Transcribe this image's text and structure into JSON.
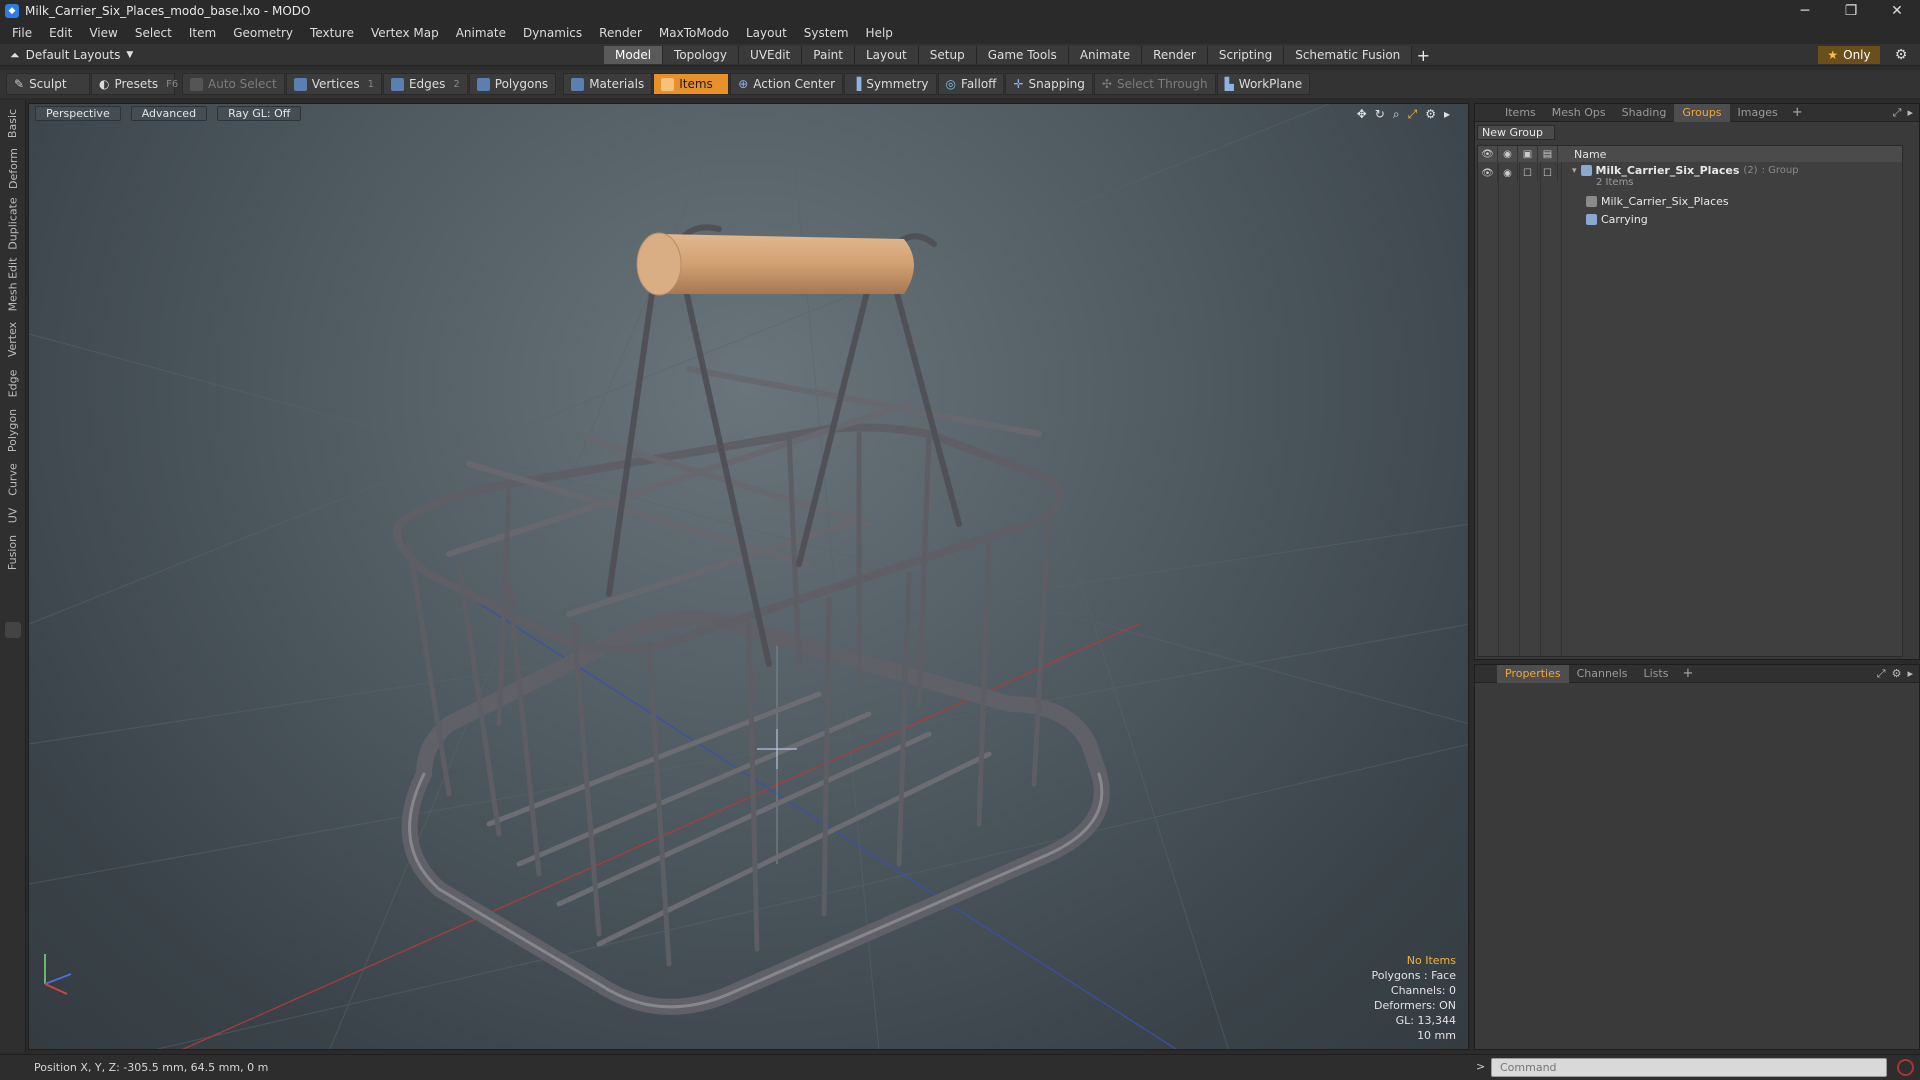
{
  "window": {
    "title": "Milk_Carrier_Six_Places_modo_base.lxo - MODO",
    "controls": [
      "─",
      "❐",
      "✕"
    ]
  },
  "menu": [
    "File",
    "Edit",
    "View",
    "Select",
    "Item",
    "Geometry",
    "Texture",
    "Vertex Map",
    "Animate",
    "Dynamics",
    "Render",
    "MaxToModo",
    "Layout",
    "System",
    "Help"
  ],
  "layout_bar": {
    "layouts_label": "Default Layouts",
    "tabs": [
      "Model",
      "Topology",
      "UVEdit",
      "Paint",
      "Layout",
      "Setup",
      "Game Tools",
      "Animate",
      "Render",
      "Scripting",
      "Schematic Fusion"
    ],
    "active_tab": "Model",
    "plus": "+",
    "only_label": "Only"
  },
  "toolbar": {
    "sculpt": "Sculpt",
    "presets": "Presets",
    "presets_key": "F6",
    "auto_select": "Auto Select",
    "vertices": "Vertices",
    "vertices_key": "1",
    "edges": "Edges",
    "edges_key": "2",
    "polygons": "Polygons",
    "materials": "Materials",
    "items": "Items",
    "action_center": "Action Center",
    "symmetry": "Symmetry",
    "falloff": "Falloff",
    "snapping": "Snapping",
    "select_through": "Select Through",
    "workplane": "WorkPlane"
  },
  "left_tabs": [
    "Basic",
    "Deform",
    "Duplicate",
    "Mesh Edit",
    "Vertex",
    "Edge",
    "Polygon",
    "Curve",
    "UV",
    "Fusion"
  ],
  "viewport": {
    "view_label": "Perspective",
    "advanced_label": "Advanced",
    "raygl_label": "Ray GL: Off",
    "stats": {
      "no_items": "No Items",
      "polygons": "Polygons : Face",
      "channels": "Channels: 0",
      "deformers": "Deformers: ON",
      "gl": "GL: 13,344",
      "scale": "10 mm"
    }
  },
  "right_top": {
    "tabs": [
      "Items",
      "Mesh Ops",
      "Shading",
      "Groups",
      "Images"
    ],
    "active_tab": "Groups",
    "new_group": "New Group",
    "name_header": "Name",
    "group": {
      "name": "Milk_Carrier_Six_Places",
      "count": "(2)",
      "kind": ": Group",
      "items_label": "2 Items",
      "children": [
        "Milk_Carrier_Six_Places",
        "Carrying"
      ]
    }
  },
  "right_bottom": {
    "tabs": [
      "Properties",
      "Channels",
      "Lists"
    ],
    "active_tab": "Properties"
  },
  "status": {
    "position": "Position X, Y, Z:  -305.5 mm, 64.5 mm, 0 m",
    "command_placeholder": "Command"
  },
  "colors": {
    "accent": "#e8912a",
    "tab_active_text": "#f0a63a",
    "warn_text": "#f2b33d"
  }
}
